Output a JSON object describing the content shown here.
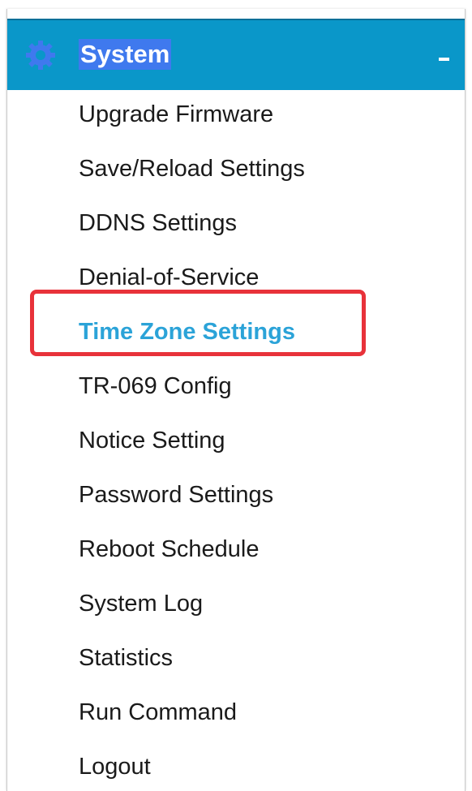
{
  "header": {
    "icon": "gear-icon",
    "title": "System",
    "collapse_label": "-"
  },
  "menu": {
    "items": [
      {
        "label": "Upgrade Firmware"
      },
      {
        "label": "Save/Reload Settings"
      },
      {
        "label": "DDNS Settings"
      },
      {
        "label": "Denial-of-Service"
      },
      {
        "label": "Time Zone Settings",
        "active": true
      },
      {
        "label": "TR-069 Config"
      },
      {
        "label": "Notice Setting"
      },
      {
        "label": "Password Settings"
      },
      {
        "label": "Reboot Schedule"
      },
      {
        "label": "System Log"
      },
      {
        "label": "Statistics"
      },
      {
        "label": "Run Command"
      },
      {
        "label": "Logout"
      }
    ]
  },
  "colors": {
    "header_bg": "#0a97c9",
    "title_highlight": "#3f79ee",
    "active_item": "#2ba3d8",
    "highlight_border": "#e8323a"
  }
}
